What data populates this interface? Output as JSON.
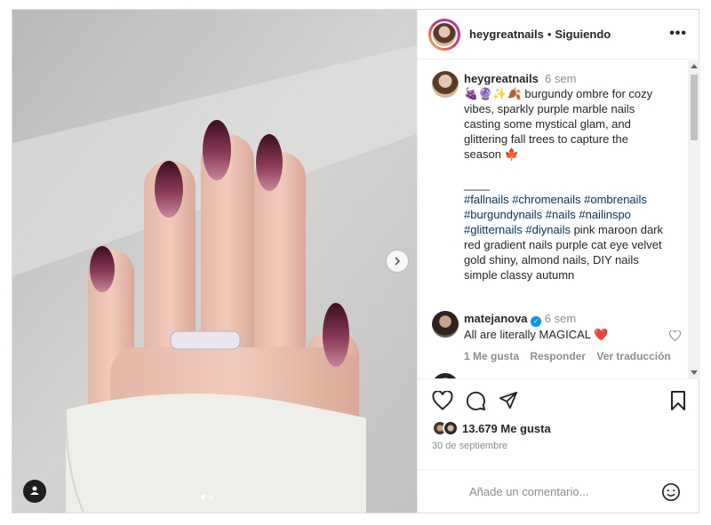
{
  "post": {
    "username": "heygreatnails",
    "follow_status": "Siguiendo",
    "separator": "•",
    "more": "•••"
  },
  "caption": {
    "username": "heygreatnails",
    "time": "6 sem",
    "line1": "🍇🔮✨🍂 burgundy ombre for cozy",
    "line2": "vibes, sparkly purple marble nails",
    "line3": "casting some mystical glam, and",
    "line4": "glittering fall trees to capture the",
    "line5": "season 🍁",
    "divider": "____",
    "tags1": "#fallnails #chromenails #ombrenails",
    "tags2": "#burgundynails #nails #nailinspo",
    "tags3_hash": "#glitternails #diynails",
    "tags3_rest": " pink maroon dark",
    "line6": "red gradient nails purple cat eye velvet",
    "line7": "gold shiny, almond nails, DIY nails",
    "line8": "simple classy autumn"
  },
  "comment": {
    "username": "matejanova",
    "time": "6 sem",
    "text": "All are literally MAGICAL ❤️",
    "likes_label": "1 Me gusta",
    "reply_label": "Responder",
    "translate_label": "Ver traducción"
  },
  "stats": {
    "likes": "13.679 Me gusta",
    "date": "30 de septiembre"
  },
  "composer": {
    "placeholder": "Añade un comentario..."
  },
  "icons": {
    "like": "heart-icon",
    "comment": "comment-icon",
    "share": "paper-plane-icon",
    "save": "bookmark-icon",
    "emoji": "smiley-icon",
    "next": "chevron-right-icon",
    "tag": "user-tag-icon"
  },
  "colors": {
    "link": "#00376b",
    "verified": "#0095f6",
    "heart": "#ed4956",
    "muted": "#8e8e8e"
  }
}
